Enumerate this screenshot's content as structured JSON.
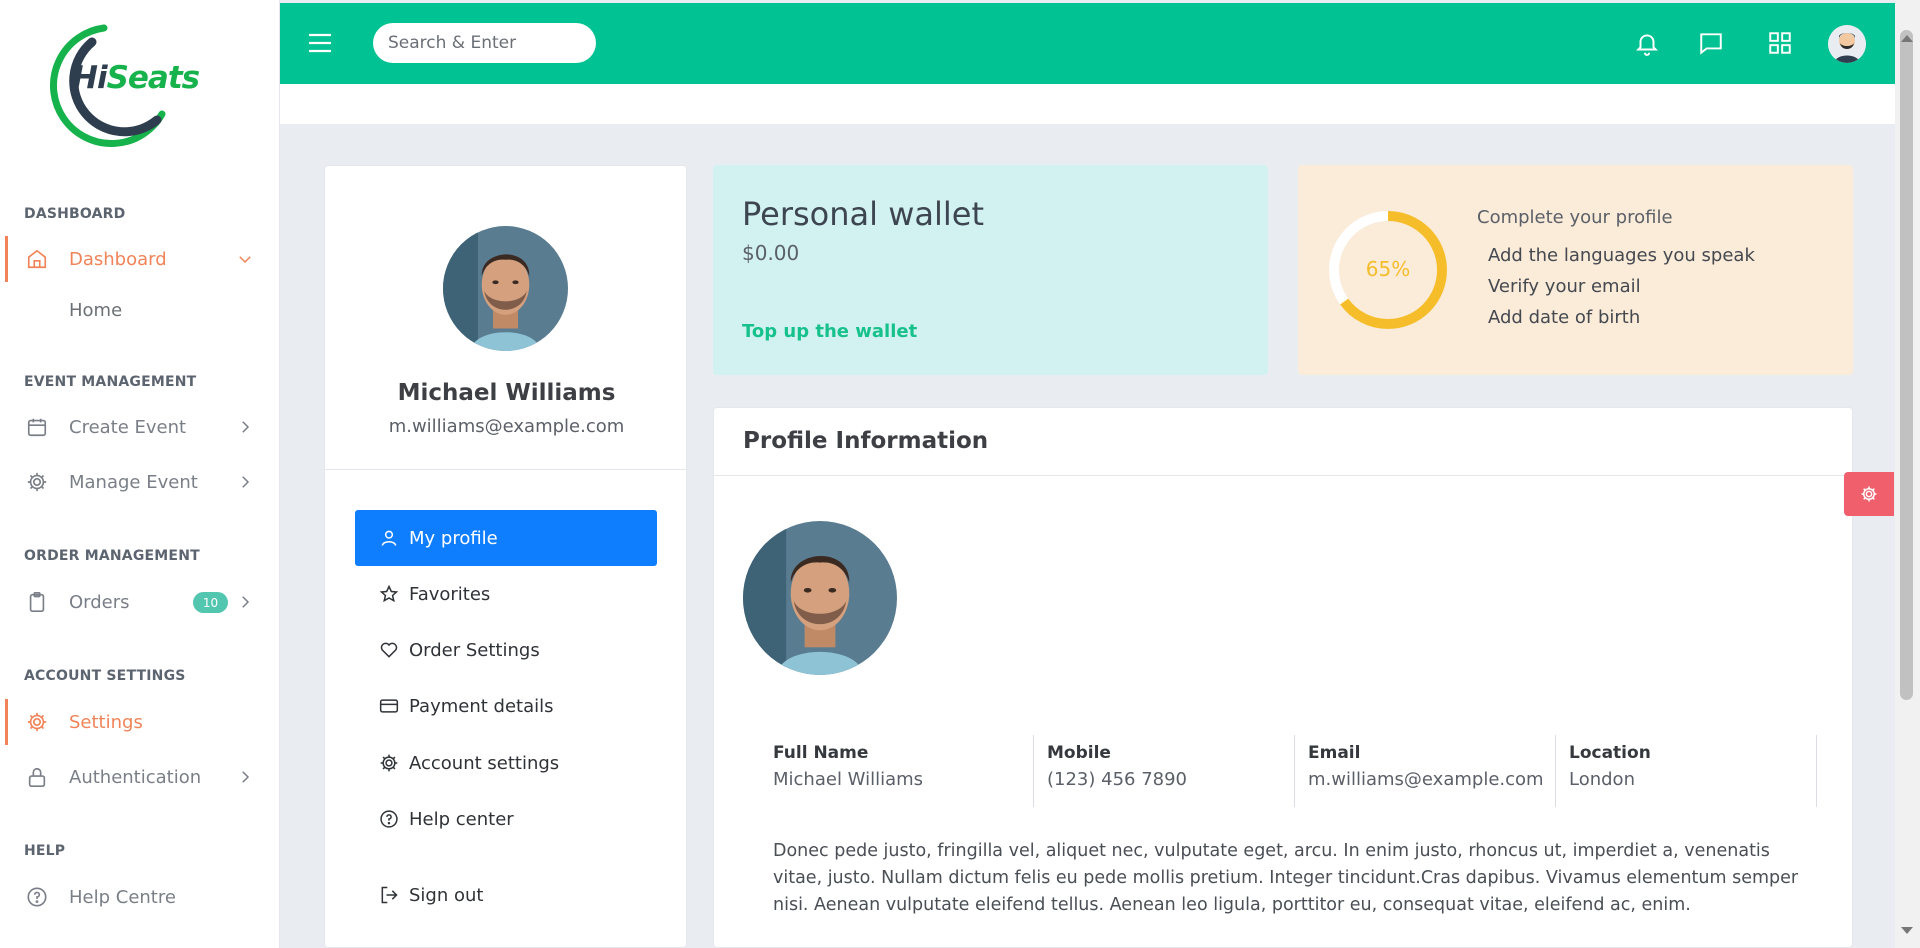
{
  "brand": {
    "logo_text_a": "Hi",
    "logo_text_b": "Seats",
    "logo_alt": "HiSeats"
  },
  "sidebar": {
    "sections": {
      "dashboard": "DASHBOARD",
      "event_management": "EVENT MANAGEMENT",
      "order_management": "ORDER MANAGEMENT",
      "account_settings": "ACCOUNT SETTINGS",
      "help": "HELP"
    },
    "items": {
      "dashboard": "Dashboard",
      "home": "Home",
      "create_event": "Create Event",
      "manage_event": "Manage Event",
      "orders": "Orders",
      "orders_badge": "10",
      "settings": "Settings",
      "authentication": "Authentication",
      "help_centre": "Help Centre"
    }
  },
  "header": {
    "search_placeholder": "Search & Enter",
    "icons": [
      "menu-icon",
      "bell-icon",
      "chat-icon",
      "apps-grid-icon",
      "user-avatar"
    ]
  },
  "profile_card": {
    "name": "Michael Williams",
    "email": "m.williams@example.com",
    "menu": {
      "my_profile": "My profile",
      "favorites": "Favorites",
      "order_settings": "Order Settings",
      "payment_details": "Payment details",
      "account_settings": "Account settings",
      "help_center": "Help center",
      "sign_out": "Sign out"
    }
  },
  "wallet": {
    "title": "Personal wallet",
    "amount": "$0.00",
    "link": "Top up the wallet"
  },
  "complete_profile": {
    "percent_label": "65%",
    "percent": 65,
    "title": "Complete your profile",
    "tasks": [
      "Add the languages you speak",
      "Verify your email",
      "Add date of birth"
    ]
  },
  "profile_info": {
    "title": "Profile Information",
    "fields": [
      {
        "label": "Full Name",
        "value": "Michael Williams"
      },
      {
        "label": "Mobile",
        "value": "(123) 456 7890"
      },
      {
        "label": "Email",
        "value": "m.williams@example.com"
      },
      {
        "label": "Location",
        "value": "London"
      }
    ],
    "bio": "Donec pede justo, fringilla vel, aliquet nec, vulputate eget, arcu. In enim justo, rhoncus ut, imperdiet a, venenatis vitae, justo. Nullam dictum felis eu pede mollis pretium. Integer tincidunt.Cras dapibus. Vivamus elementum semper nisi. Aenean vulputate eleifend tellus. Aenean leo ligula, porttitor eu, consequat vitae, eleifend ac, enim."
  },
  "colors": {
    "header": "#00c292",
    "accent_active": "#f08458",
    "primary_button": "#0f7efe",
    "wallet_bg": "#d2f2f2",
    "complete_bg": "#fbebd9",
    "progress": "#f6bd2b",
    "badge": "#53c6b0",
    "float_settings": "#f0606c"
  }
}
